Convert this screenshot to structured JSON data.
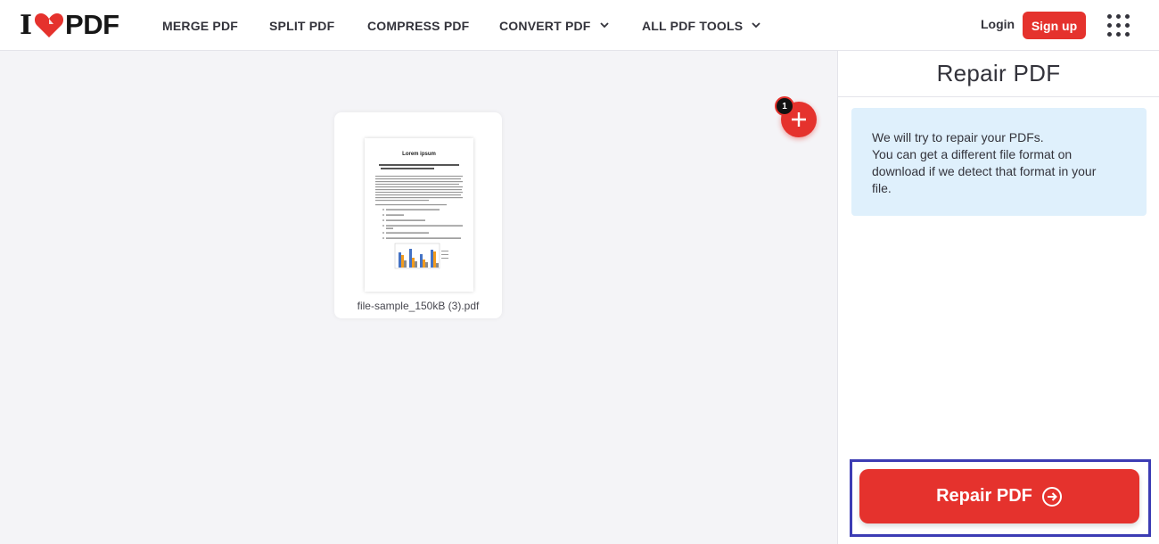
{
  "brand": {
    "logo_left": "I",
    "logo_right": "PDF",
    "accent": "#e5322d"
  },
  "nav": {
    "merge": "MERGE PDF",
    "split": "SPLIT PDF",
    "compress": "COMPRESS PDF",
    "convert": "CONVERT PDF",
    "all_tools": "ALL PDF TOOLS"
  },
  "auth": {
    "login": "Login",
    "signup": "Sign up"
  },
  "workspace": {
    "file_name": "file-sample_150kB (3).pdf",
    "file_count": "1",
    "thumb_title": "Lorem ipsum"
  },
  "sidebar": {
    "title": "Repair PDF",
    "info_line1": "We will try to repair your PDFs.",
    "info_line2": "You can get a different file format on",
    "info_line3": "download if we detect that format in your",
    "info_line4": "file.",
    "action": "Repair PDF"
  }
}
